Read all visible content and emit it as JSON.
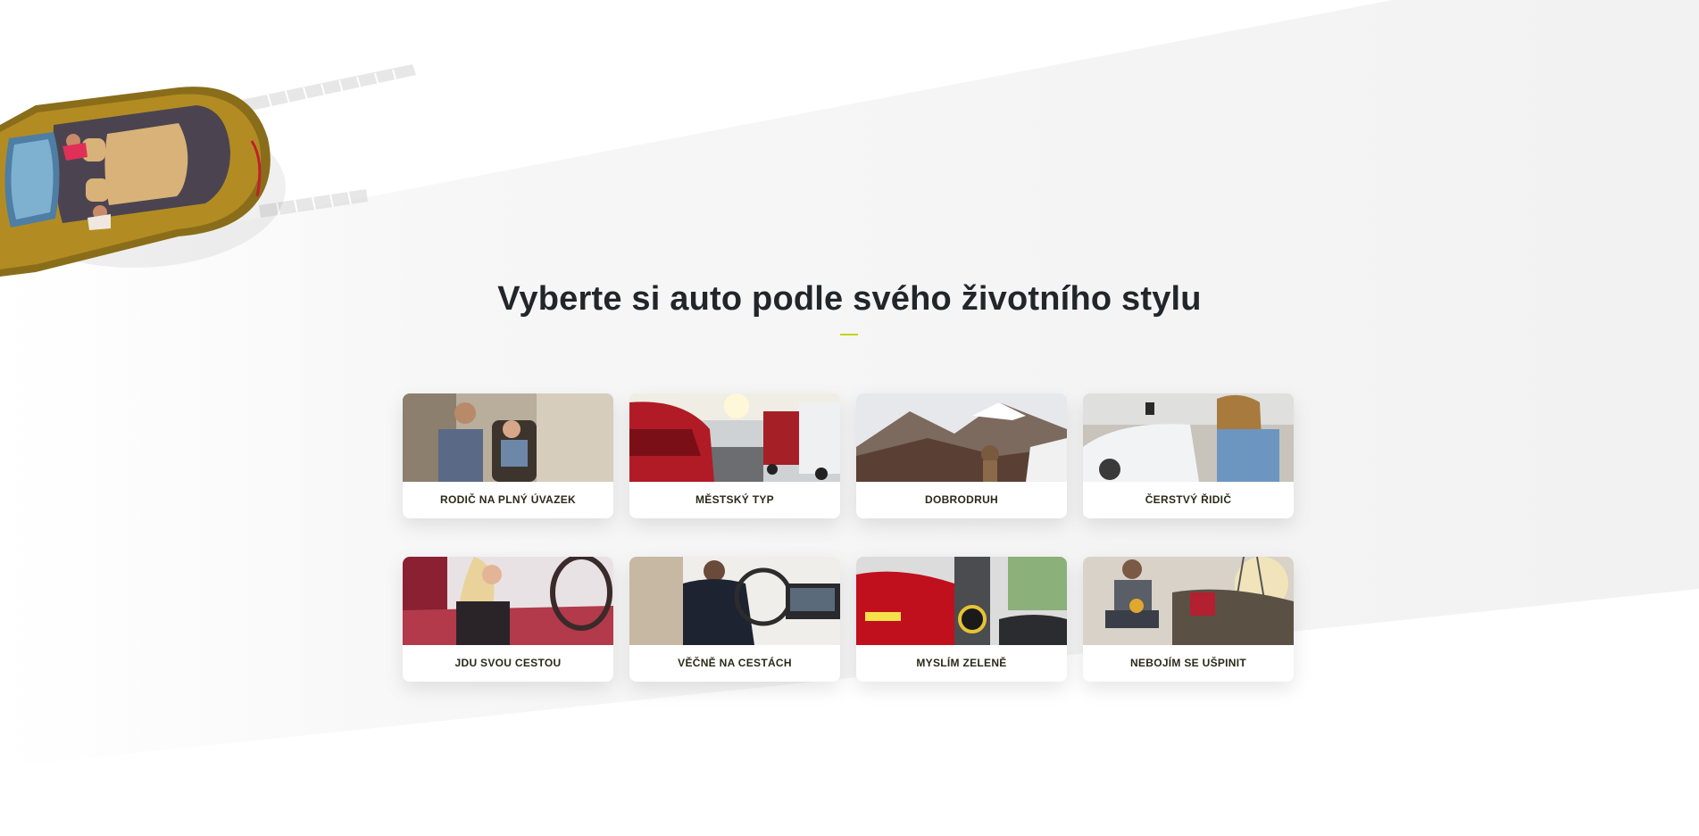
{
  "section": {
    "title": "Vyberte si auto podle svého životního stylu"
  },
  "colors": {
    "accent": "#c8d21f",
    "title_text": "#22262a",
    "card_label_text": "#2a2a1a"
  },
  "hero": {
    "image": "convertible-car-top-view-illustration"
  },
  "cards": [
    {
      "label": "RODIČ NA PLNÝ ÚVAZEK",
      "image": "parent-with-child-car-seat-photo"
    },
    {
      "label": "MĚSTSKÝ TYP",
      "image": "city-traffic-cars-photo"
    },
    {
      "label": "DOBRODRUH",
      "image": "mountain-adventure-photo"
    },
    {
      "label": "ČERSTVÝ ŘIDIČ",
      "image": "young-driver-with-keys-photo"
    },
    {
      "label": "JDU SVOU CESTOU",
      "image": "woman-driving-photo"
    },
    {
      "label": "VĚČNĚ NA CESTÁCH",
      "image": "man-driving-interior-photo"
    },
    {
      "label": "MYSLÍM ZELENĚ",
      "image": "electric-car-charging-photo"
    },
    {
      "label": "NEBOJÍM SE UŠPINIT",
      "image": "worker-with-pickup-truck-photo"
    }
  ]
}
